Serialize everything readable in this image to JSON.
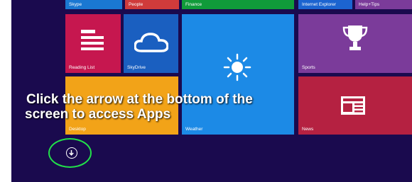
{
  "screenshot": {
    "instruction_line1": "Click the arrow at the bottom of the",
    "instruction_line2": "screen to access Apps"
  },
  "tiles_top_row": [
    {
      "label": "Skype",
      "color": "#1a78d2"
    },
    {
      "label": "People",
      "color": "#d03b3b"
    },
    {
      "label": "Finance",
      "color": "#109b3a"
    },
    {
      "label": "Internet Explorer",
      "color": "#1c64d0"
    },
    {
      "label": "Help+Tips",
      "color": "#7b3b9a"
    }
  ],
  "tiles": {
    "reading_list": {
      "label": "Reading List",
      "color": "#c6174f",
      "icon": "reading-list-icon"
    },
    "skydrive": {
      "label": "SkyDrive",
      "color": "#1a5fc0",
      "icon": "cloud-icon"
    },
    "weather": {
      "label": "Weather",
      "color": "#1c8ae6",
      "icon": "sun-icon"
    },
    "sports": {
      "label": "Sports",
      "color": "#7b3b9a",
      "icon": "trophy-icon"
    },
    "desktop": {
      "label": "Desktop",
      "color": "#f2a318"
    },
    "news": {
      "label": "News",
      "color": "#b52141",
      "icon": "news-icon"
    }
  },
  "highlight_color": "#22e04a",
  "apps_arrow_icon": "down-arrow-circle-icon"
}
